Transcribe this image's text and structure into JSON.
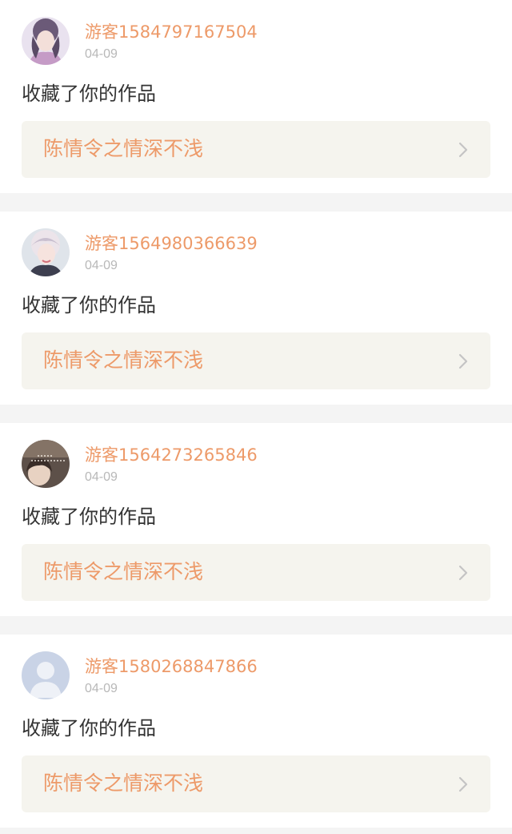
{
  "notifications": [
    {
      "username": "游客1584797167504",
      "date": "04-09",
      "action": "收藏了你的作品",
      "work_title": "陈情令之情深不浅",
      "avatar_icon": "avatar-photo-purple"
    },
    {
      "username": "游客1564980366639",
      "date": "04-09",
      "action": "收藏了你的作品",
      "work_title": "陈情令之情深不浅",
      "avatar_icon": "avatar-photo-light"
    },
    {
      "username": "游客1564273265846",
      "date": "04-09",
      "action": "收藏了你的作品",
      "work_title": "陈情令之情深不浅",
      "avatar_icon": "avatar-photo-dark"
    },
    {
      "username": "游客1580268847866",
      "date": "04-09",
      "action": "收藏了你的作品",
      "work_title": "陈情令之情深不浅",
      "avatar_icon": "default-user-icon"
    }
  ],
  "colors": {
    "accent": "#ed9a69",
    "date_text": "#b8b8b8",
    "body_text": "#333333",
    "link_background": "#f5f4ee",
    "page_background": "#f4f4f4"
  }
}
